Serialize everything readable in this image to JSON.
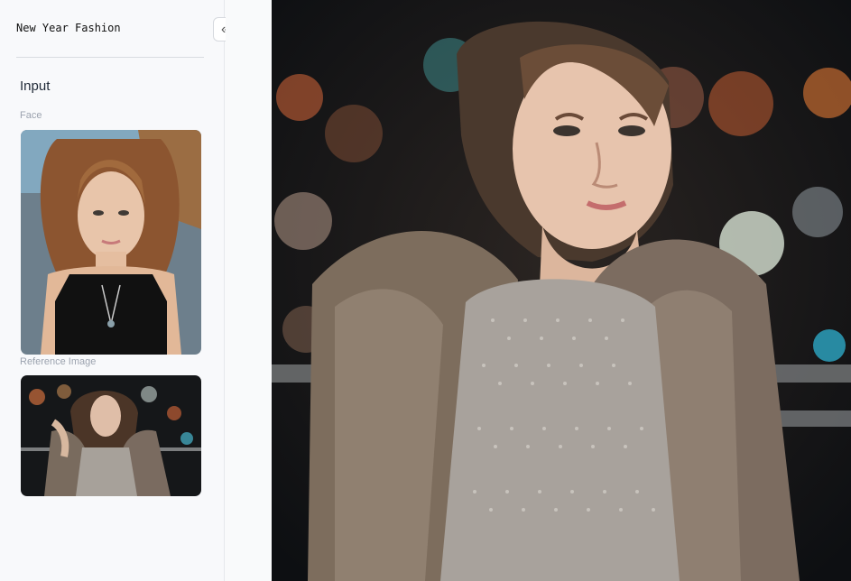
{
  "app": {
    "title": "New Year Fashion"
  },
  "sidebar": {
    "section_title": "Input",
    "face_label": "Face",
    "reference_label": "Reference Image"
  },
  "controls": {
    "collapse_icon": "double-chevron-left-icon",
    "collapse_glyph": "«"
  }
}
